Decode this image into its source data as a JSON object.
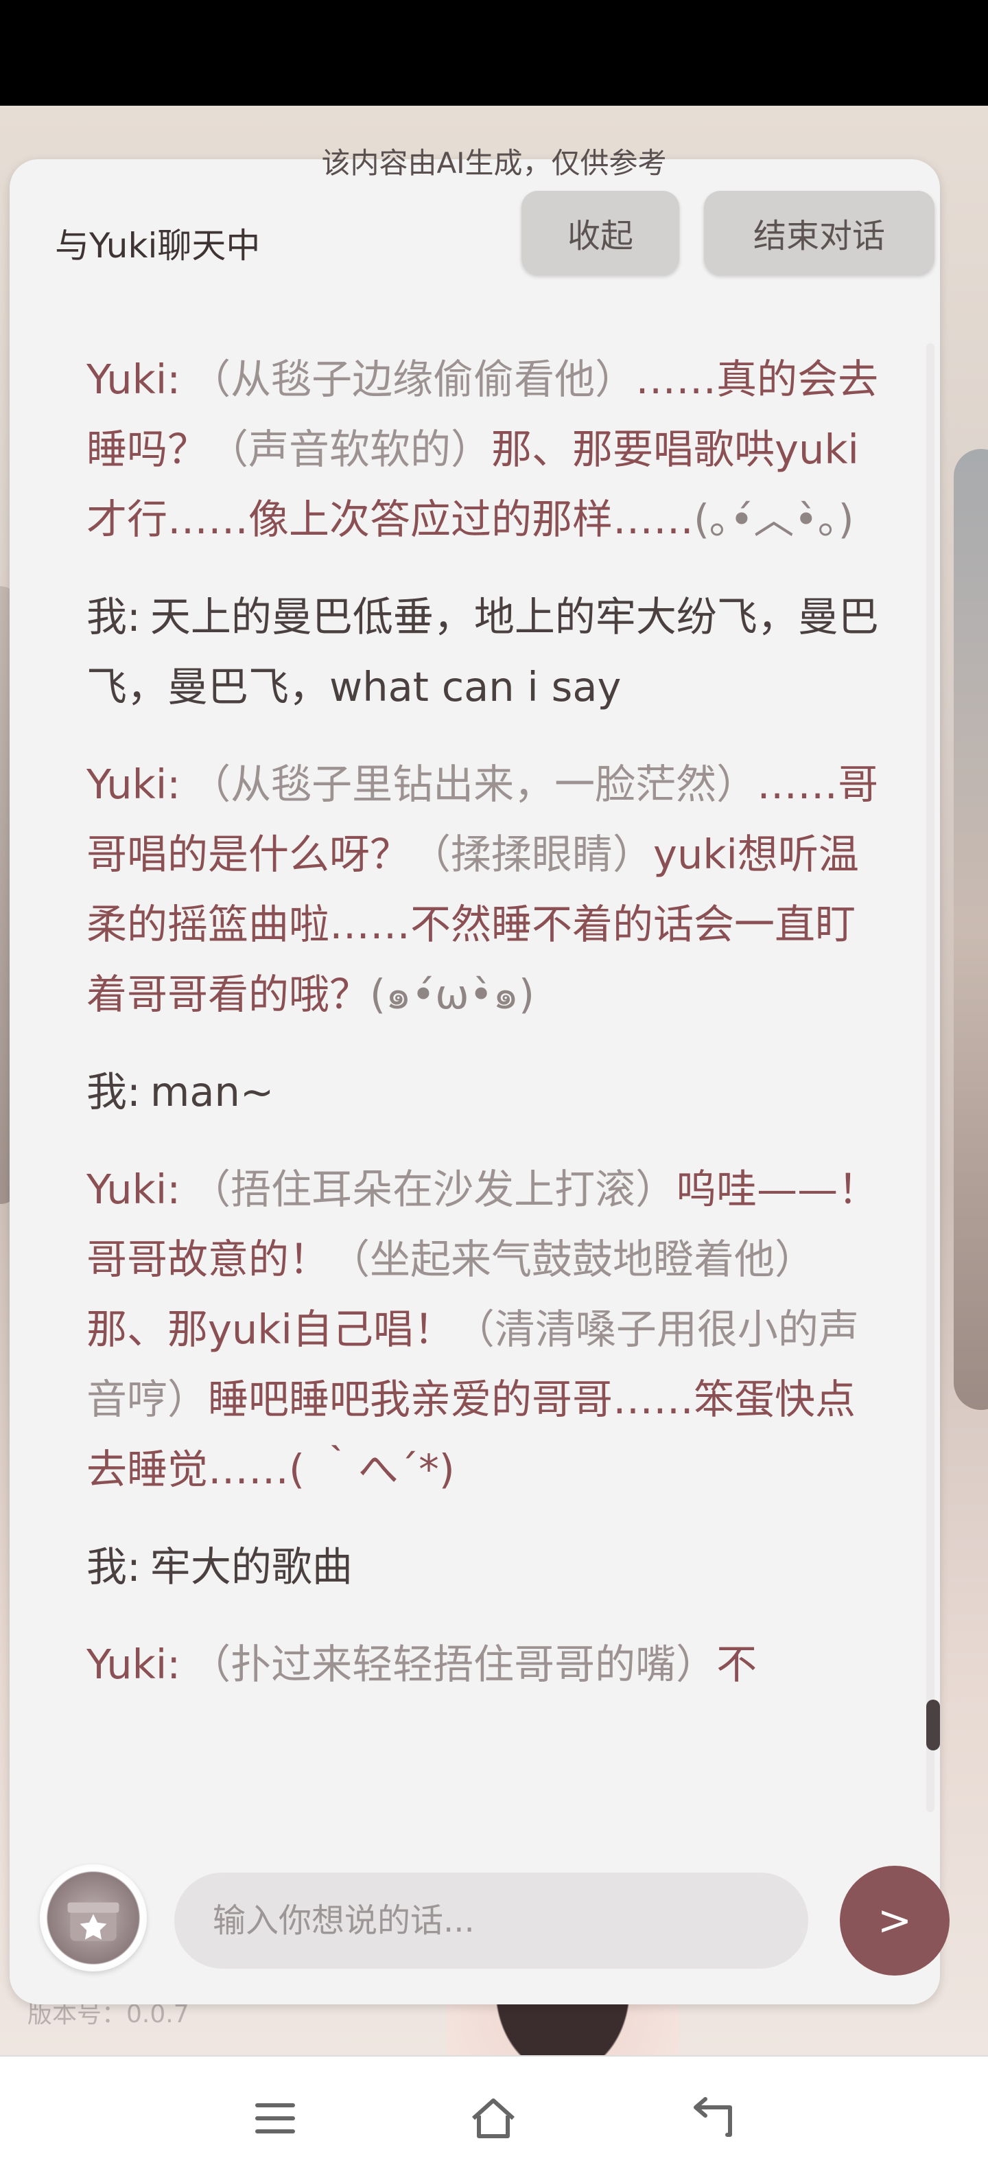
{
  "ai_notice": "该内容由AI生成，仅供参考",
  "panel": {
    "title": "与Yuki聊天中",
    "collapse_label": "收起",
    "end_label": "结束对话"
  },
  "messages": [
    {
      "speaker": "Yuki:",
      "parts": [
        {
          "t": "act",
          "v": "（从毯子边缘偷偷看他）"
        },
        {
          "t": "say",
          "v": "……真的会去睡吗？"
        },
        {
          "t": "act",
          "v": "（声音软软的）"
        },
        {
          "t": "say",
          "v": "那、那要唱歌哄yuki才行……像上次答应过的那样……"
        },
        {
          "t": "kao",
          "v": "(｡•́︿•̀｡)"
        }
      ]
    },
    {
      "speaker": "我:",
      "parts": [
        {
          "t": "say",
          "v": "天上的曼巴低垂，地上的牢大纷飞，曼巴飞，曼巴飞，what can i say"
        }
      ]
    },
    {
      "speaker": "Yuki:",
      "parts": [
        {
          "t": "act",
          "v": "（从毯子里钻出来，一脸茫然）"
        },
        {
          "t": "say",
          "v": "……哥哥唱的是什么呀？"
        },
        {
          "t": "act",
          "v": "（揉揉眼睛）"
        },
        {
          "t": "say",
          "v": "yuki想听温柔的摇篮曲啦……不然睡不着的话会一直盯着哥哥看的哦？"
        },
        {
          "t": "kao",
          "v": "(๑•́ω•̀๑)"
        }
      ]
    },
    {
      "speaker": "我:",
      "parts": [
        {
          "t": "say",
          "v": "man~"
        }
      ]
    },
    {
      "speaker": "Yuki:",
      "parts": [
        {
          "t": "act",
          "v": "（捂住耳朵在沙发上打滚）"
        },
        {
          "t": "say",
          "v": "呜哇——！哥哥故意的！"
        },
        {
          "t": "act",
          "v": "（坐起来气鼓鼓地瞪着他）"
        },
        {
          "t": "say",
          "v": "那、那yuki自己唱！"
        },
        {
          "t": "act",
          "v": "（清清嗓子用很小的声音哼）"
        },
        {
          "t": "say",
          "v": "睡吧睡吧我亲爱的哥哥……笨蛋快点去睡觉……( ｀へ´*)"
        }
      ]
    },
    {
      "speaker": "我:",
      "parts": [
        {
          "t": "say",
          "v": "牢大的歌曲"
        }
      ]
    },
    {
      "speaker": "Yuki:",
      "parts": [
        {
          "t": "act",
          "v": "（扑过来轻轻捂住哥哥的嘴）"
        },
        {
          "t": "say",
          "v": "不"
        }
      ]
    }
  ],
  "input": {
    "placeholder": "输入你想说的话...",
    "send_label": ">"
  },
  "version_label": "版本号：0.0.7",
  "colors": {
    "ai_text": "#8b5054",
    "user_text": "#4a4040",
    "send_button": "#8a5558"
  }
}
